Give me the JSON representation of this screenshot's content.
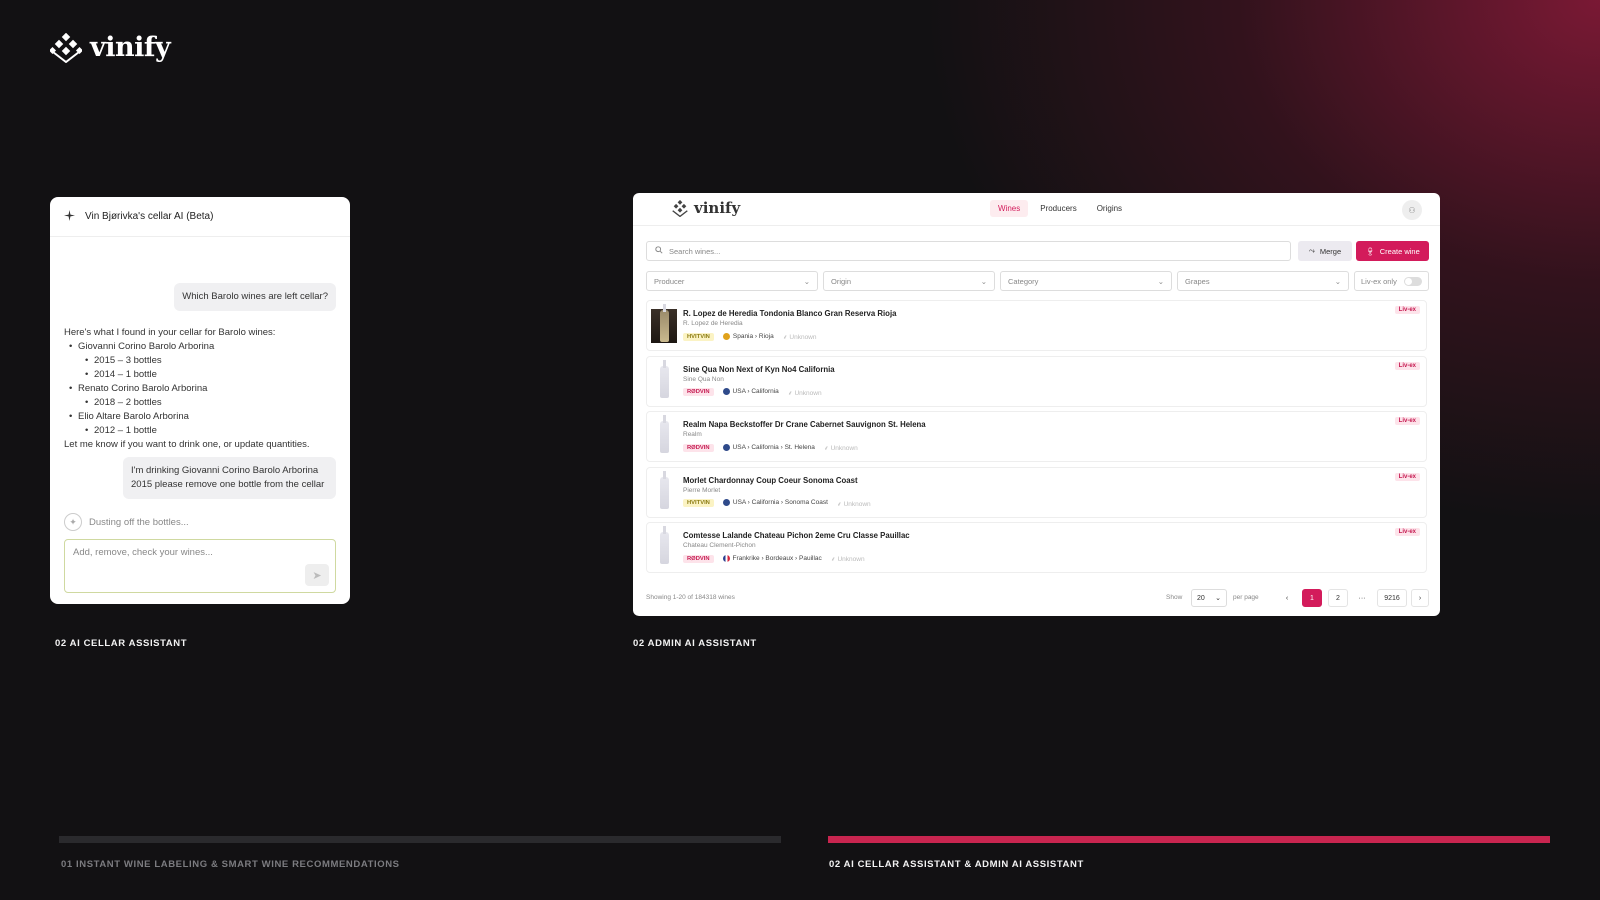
{
  "brand": {
    "name": "vinify"
  },
  "chat": {
    "title": "Vin Bjørivka's cellar AI (Beta)",
    "user_question": "Which Barolo wines are left cellar?",
    "reply_intro": "Here's what I found in your cellar for Barolo wines:",
    "reply_items": [
      {
        "wine": "Giovanni Corino Barolo Arborina",
        "details": [
          "2015 – 3 bottles",
          "2014 – 1 bottle"
        ]
      },
      {
        "wine": "Renato Corino Barolo Arborina",
        "details": [
          "2018 – 2 bottles"
        ]
      },
      {
        "wine": "Elio Altare Barolo Arborina",
        "details": [
          "2012 – 1 bottle"
        ]
      }
    ],
    "reply_outro": "Let me know if you want to drink one, or update quantities.",
    "user_message_2": "I'm drinking Giovanni Corino Barolo Arborina 2015 please remove one bottle from the cellar",
    "status": "Dusting off the bottles...",
    "input_placeholder": "Add, remove, check your wines..."
  },
  "admin": {
    "logo": "vinify",
    "tabs": [
      "Wines",
      "Producers",
      "Origins"
    ],
    "active_tab": "Wines",
    "search_placeholder": "Search wines...",
    "merge_label": "Merge",
    "create_label": "Create wine",
    "filters": [
      "Producer",
      "Origin",
      "Category",
      "Grapes"
    ],
    "liv_ex_toggle": "Liv-ex only",
    "wines": [
      {
        "name": "R. Lopez de Heredia Tondonia Blanco Gran Reserva Rioja",
        "producer": "R. Lopez de Heredia",
        "type": "HVITVIN",
        "type_kind": "white",
        "flag_color": "#e0a21b",
        "origin": "Spania › Rioja",
        "grapes": "Unknown",
        "badge": "Liv-ex",
        "thumb": "photo"
      },
      {
        "name": "Sine Qua Non Next of Kyn No4 California",
        "producer": "Sine Qua Non",
        "type": "RØDVIN",
        "type_kind": "red",
        "flag_color": "#2f4a8a",
        "origin": "USA › California",
        "grapes": "Unknown",
        "badge": "Liv-ex",
        "thumb": "bottle"
      },
      {
        "name": "Realm Napa Beckstoffer Dr Crane Cabernet Sauvignon St. Helena",
        "producer": "Realm",
        "type": "RØDVIN",
        "type_kind": "red",
        "flag_color": "#2f4a8a",
        "origin": "USA › California › St. Helena",
        "grapes": "Unknown",
        "badge": "Liv-ex",
        "thumb": "bottle"
      },
      {
        "name": "Morlet Chardonnay Coup Coeur Sonoma Coast",
        "producer": "Pierre Morlet",
        "type": "HVITVIN",
        "type_kind": "white",
        "flag_color": "#2f4a8a",
        "origin": "USA › California › Sonoma Coast",
        "grapes": "Unknown",
        "badge": "Liv-ex",
        "thumb": "bottle"
      },
      {
        "name": "Comtesse Lalande Chateau Pichon 2eme Cru Classe Pauillac",
        "producer": "Chateau Clement-Pichon",
        "type": "RØDVIN",
        "type_kind": "red",
        "flag_color": "#2b3f8f",
        "origin": "Frankrike › Bordeaux › Pauillac",
        "grapes": "Unknown",
        "badge": "Liv-ex",
        "thumb": "bottle"
      }
    ],
    "pagination": {
      "summary": "Showing 1-20 of 184318 wines",
      "show_label": "Show",
      "per_page_value": "20",
      "per_page_label": "per page",
      "pages": [
        "1",
        "2",
        "···",
        "9216"
      ],
      "current_page": "1"
    }
  },
  "captions": {
    "chat": "02 AI CELLAR ASSISTANT",
    "admin": "02 ADMIN AI ASSISTANT"
  },
  "steps": [
    {
      "label": "01 INSTANT WINE LABELING & SMART WINE RECOMMENDATIONS",
      "active": false
    },
    {
      "label": "02 AI CELLAR ASSISTANT &  ADMIN AI ASSISTANT",
      "active": true
    }
  ],
  "colors": {
    "accent": "#d31b5b",
    "bar_inactive": "#2a2a2d",
    "bar_active": "#c8254f"
  }
}
